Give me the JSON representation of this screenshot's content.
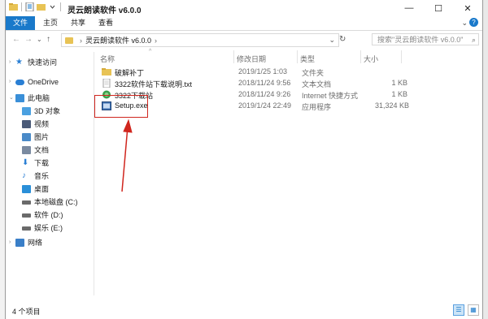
{
  "window": {
    "title": "灵云朗读软件 v6.0.0",
    "minimize": "—",
    "maximize": "☐",
    "close": "✕"
  },
  "ribbon": {
    "tabs": [
      "文件",
      "主页",
      "共享",
      "查看"
    ],
    "chevron": "⌄",
    "help": "?"
  },
  "address": {
    "back": "←",
    "forward": "→",
    "up_recent": "⌄",
    "up": "↑",
    "chevron": "›",
    "path": "灵云朗读软件 v6.0.0",
    "dropdown": "⌄",
    "refresh": "↻",
    "search_placeholder": "搜索\"灵云朗读软件 v6.0.0\"",
    "search_icon": "⌕"
  },
  "sidebar": {
    "items": [
      {
        "label": "快速访问",
        "icon": "star-icon",
        "color": "#2a7fd4"
      },
      {
        "label": "OneDrive",
        "icon": "cloud-icon",
        "color": "#2a7fd4"
      },
      {
        "label": "此电脑",
        "icon": "computer-icon",
        "color": "#3a8fd8"
      },
      {
        "label": "3D 对象",
        "icon": "cube-icon",
        "color": "#4aa0e0"
      },
      {
        "label": "视频",
        "icon": "video-icon",
        "color": "#4a5a78"
      },
      {
        "label": "图片",
        "icon": "picture-icon",
        "color": "#4a8ac8"
      },
      {
        "label": "文档",
        "icon": "document-icon",
        "color": "#7a8aa0"
      },
      {
        "label": "下载",
        "icon": "download-icon",
        "color": "#2a7fd4"
      },
      {
        "label": "音乐",
        "icon": "music-icon",
        "color": "#2a7fd4"
      },
      {
        "label": "桌面",
        "icon": "desktop-icon",
        "color": "#2a8fd8"
      },
      {
        "label": "本地磁盘 (C:)",
        "icon": "drive-icon",
        "color": "#6a6a6a"
      },
      {
        "label": "软件 (D:)",
        "icon": "drive-icon",
        "color": "#6a6a6a"
      },
      {
        "label": "娱乐 (E:)",
        "icon": "drive-icon",
        "color": "#6a6a6a"
      },
      {
        "label": "网络",
        "icon": "network-icon",
        "color": "#3a7fc8"
      }
    ]
  },
  "columns": {
    "name": "名称",
    "date": "修改日期",
    "type": "类型",
    "size": "大小",
    "sort_arrow": "^"
  },
  "files": [
    {
      "name": "破解补丁",
      "date": "2019/1/25 1:03",
      "type": "文件夹",
      "size": "",
      "icon": "folder-icon"
    },
    {
      "name": "3322软件站下载说明.txt",
      "date": "2018/11/24 9:56",
      "type": "文本文档",
      "size": "1 KB",
      "icon": "text-file-icon"
    },
    {
      "name": "3322下载站",
      "date": "2018/11/24 9:26",
      "type": "Internet 快捷方式",
      "size": "1 KB",
      "icon": "internet-shortcut-icon"
    },
    {
      "name": "Setup.exe",
      "date": "2019/1/24 22:49",
      "type": "应用程序",
      "size": "31,324 KB",
      "icon": "setup-exe-icon"
    }
  ],
  "status": {
    "count": "4 个项目",
    "details_view": "☰",
    "icons_view": "▦"
  },
  "colors": {
    "accent": "#1979ca",
    "highlight": "#d0261e",
    "folder": "#e8c355"
  }
}
